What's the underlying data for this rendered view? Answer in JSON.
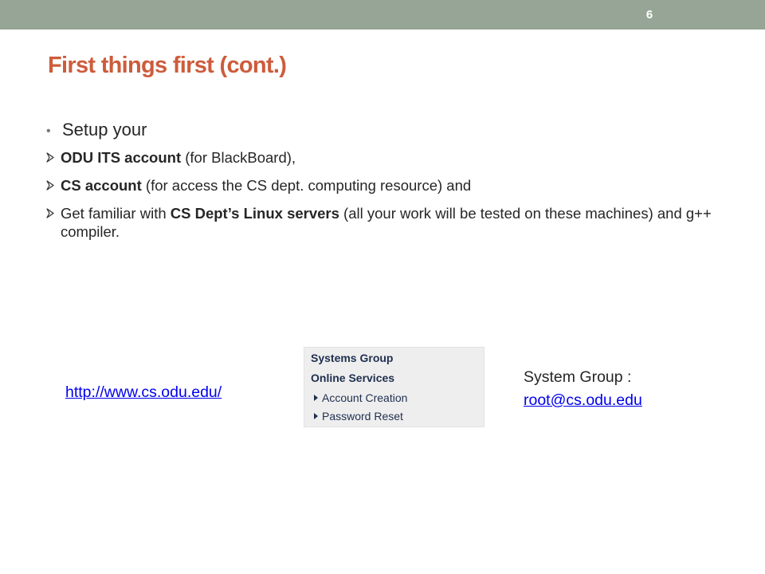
{
  "page_number": "6",
  "title": "First things first (cont.)",
  "main_bullet": "Setup your",
  "sub_items": [
    {
      "bold": "ODU ITS account",
      "rest": " (for BlackBoard),"
    },
    {
      "bold": "CS account",
      "rest": " (for access the CS dept. computing resource) and"
    },
    {
      "pre": "Get familiar with ",
      "bold": "CS Dept’s Linux servers",
      "rest": " (all your work will be tested on these machines) and g++ compiler."
    }
  ],
  "cs_link": "http://www.cs.odu.edu/",
  "menu": {
    "heading1": "Systems Group",
    "heading2": "Online Services",
    "items": [
      "Account Creation",
      "Password Reset"
    ]
  },
  "contact": {
    "label": "System Group :",
    "email": "root@cs.odu.edu"
  },
  "colors": {
    "top_bar": "#96a596",
    "title": "#cd5c3c",
    "link": "#0000ee",
    "arrow_bullet": "#2d2d2d"
  }
}
